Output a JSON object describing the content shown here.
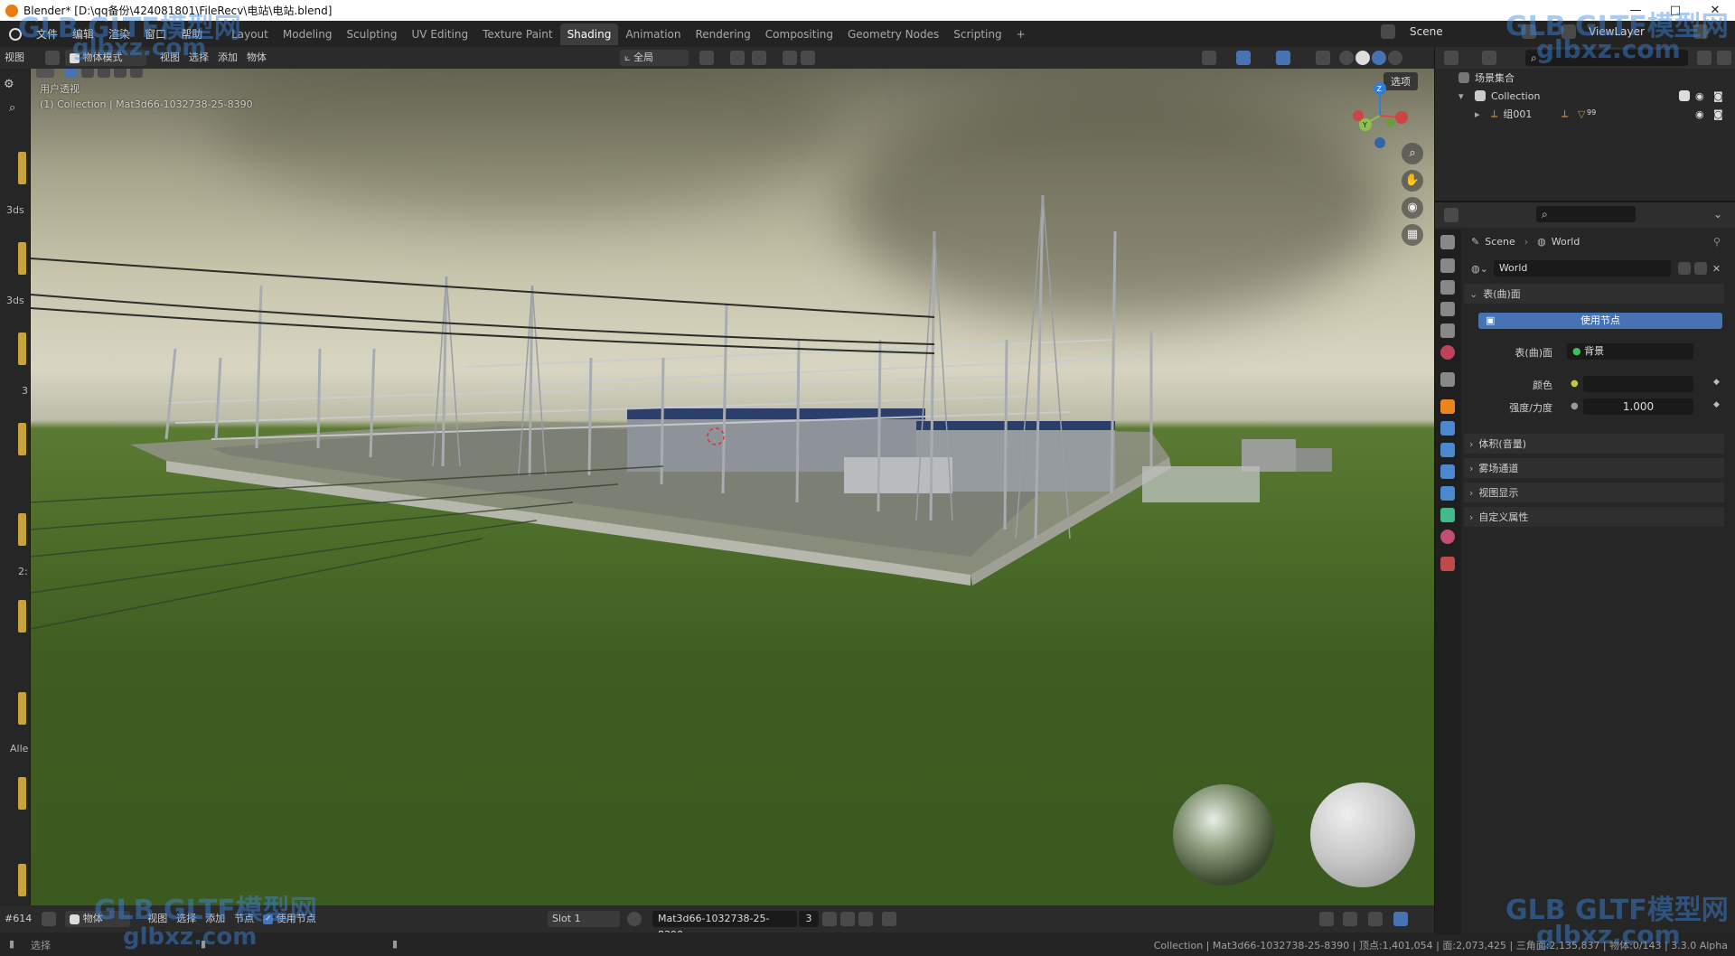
{
  "title_bar": {
    "title": "Blender* [D:\\qq备份\\424081801\\FileRecv\\电站\\电站.blend]",
    "minimize": "—",
    "maximize": "□",
    "close": "✕"
  },
  "menu": {
    "items": [
      "文件",
      "编辑",
      "渲染",
      "窗口",
      "帮助"
    ]
  },
  "workspaces": {
    "tabs": [
      "Layout",
      "Modeling",
      "Sculpting",
      "UV Editing",
      "Texture Paint",
      "Shading",
      "Animation",
      "Rendering",
      "Compositing",
      "Geometry Nodes",
      "Scripting"
    ],
    "active": "Shading",
    "add": "+"
  },
  "scene_selector": {
    "label": "Scene"
  },
  "viewlayer_selector": {
    "label": "ViewLayer"
  },
  "viewport_header": {
    "editor": "视图",
    "mode": "物体模式",
    "menus": [
      "视图",
      "选择",
      "添加",
      "物体"
    ],
    "transform_orientation": "全局"
  },
  "viewport": {
    "view_name": "用户透视",
    "collection_info": "(1) Collection | Mat3d66-1032738-25-8390",
    "options_label": "选项",
    "gizmo_axes": {
      "z": "Z",
      "y": "Y"
    }
  },
  "left_toolbar": {
    "labels": [
      "3ds",
      "3ds",
      "3",
      "2:",
      "Alle"
    ]
  },
  "bottom_header": {
    "frame_label": "#614",
    "object_label": "物体",
    "menus": [
      "视图",
      "选择",
      "添加",
      "节点"
    ],
    "use_nodes_label": "使用节点",
    "slot": "Slot 1",
    "material_name": "Mat3d66-1032738-25-8390",
    "user_count": "3"
  },
  "status_bar": {
    "left": "选择",
    "right": "Collection | Mat3d66-1032738-25-8390 | 顶点:1,401,054 | 面:2,073,425 | 三角面:2,135,837 | 物体:0/143 | 3.3.0 Alpha"
  },
  "outliner": {
    "root": "场景集合",
    "collection": "Collection",
    "child": "组001",
    "child_badge": "99"
  },
  "properties": {
    "breadcrumb_scene": "Scene",
    "breadcrumb_world": "World",
    "world_name": "World",
    "section_surface": "表(曲)面",
    "use_nodes_button": "使用节点",
    "surface_label": "表(曲)面",
    "surface_value": "背景",
    "color_label": "颜色",
    "strength_label": "强度/力度",
    "strength_value": "1.000",
    "collapsed_sections": [
      "体积(音量)",
      "雾场通道",
      "视图显示",
      "自定义属性"
    ]
  },
  "watermarks": {
    "brand": "GLB GLTF模型网",
    "url": "glbxz.com"
  },
  "colors": {
    "accent_blue": "#4772b3",
    "active_tab": "#3d3d3d",
    "background": "#1d1d1d"
  }
}
